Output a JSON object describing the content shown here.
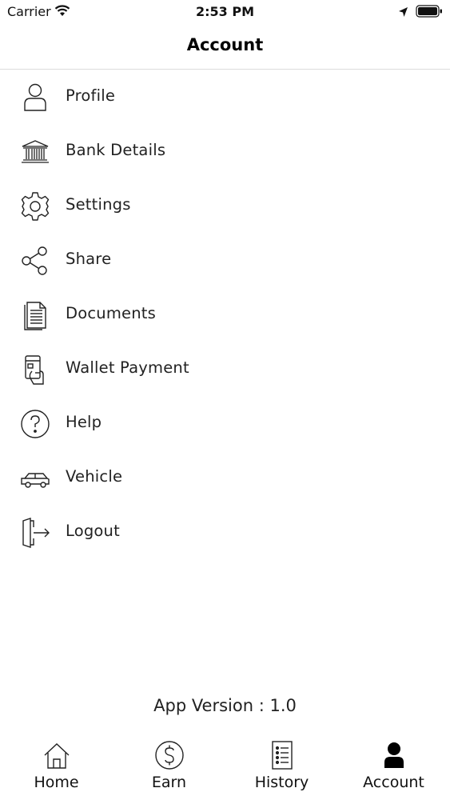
{
  "status_bar": {
    "carrier": "Carrier",
    "time": "2:53 PM"
  },
  "header": {
    "title": "Account"
  },
  "menu": {
    "items": [
      {
        "label": "Profile",
        "icon": "user-icon"
      },
      {
        "label": "Bank Details",
        "icon": "bank-icon"
      },
      {
        "label": "Settings",
        "icon": "gear-icon"
      },
      {
        "label": "Share",
        "icon": "share-icon"
      },
      {
        "label": "Documents",
        "icon": "document-icon"
      },
      {
        "label": "Wallet Payment",
        "icon": "wallet-card-icon"
      },
      {
        "label": "Help",
        "icon": "help-icon"
      },
      {
        "label": "Vehicle",
        "icon": "car-icon"
      },
      {
        "label": "Logout",
        "icon": "logout-icon"
      }
    ]
  },
  "footer": {
    "app_version": "App Version : 1.0"
  },
  "tabs": [
    {
      "label": "Home",
      "icon": "home-icon"
    },
    {
      "label": "Earn",
      "icon": "dollar-icon"
    },
    {
      "label": "History",
      "icon": "list-icon"
    },
    {
      "label": "Account",
      "icon": "person-icon",
      "active": true
    }
  ],
  "colors": {
    "text": "#111111",
    "divider": "#dcdcdc",
    "background": "#ffffff"
  }
}
